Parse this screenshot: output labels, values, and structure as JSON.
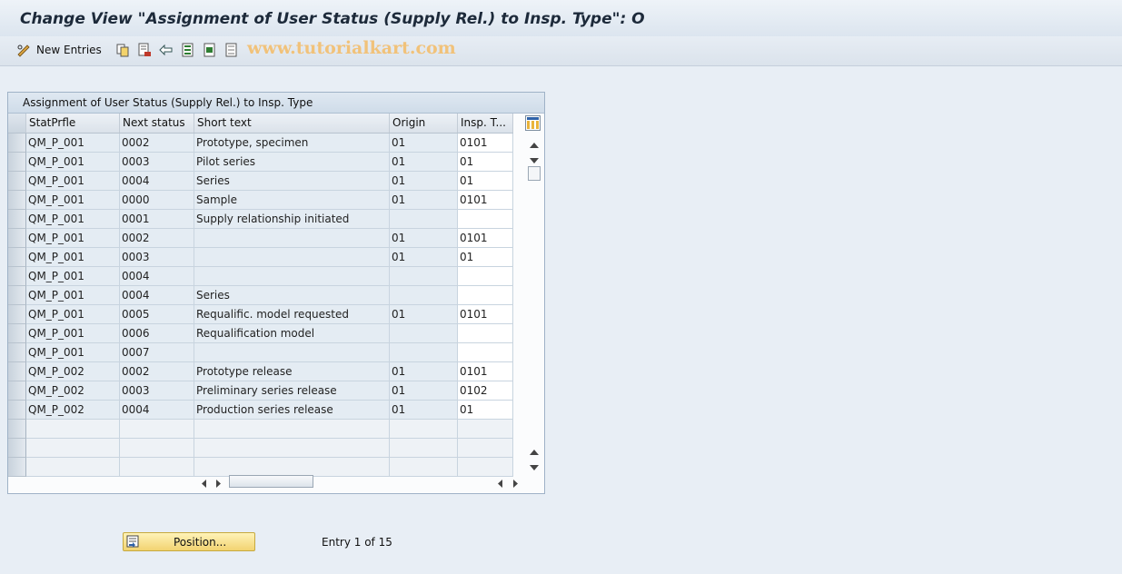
{
  "window": {
    "title": "Change View \"Assignment of User Status (Supply Rel.) to Insp. Type\": O"
  },
  "toolbar": {
    "new_entries_label": "New Entries",
    "icons": [
      "edit-glasses-icon",
      "copy-icon",
      "delete-icon",
      "undo-icon",
      "select-all-icon",
      "select-block-icon",
      "deselect-all-icon"
    ]
  },
  "watermark": "www.tutorialkart.com",
  "table": {
    "title": "Assignment of User Status (Supply Rel.) to Insp. Type",
    "columns": [
      "StatPrfle",
      "Next status",
      "Short text",
      "Origin",
      "Insp. T..."
    ],
    "rows": [
      [
        "QM_P_001",
        "0002",
        "Prototype, specimen",
        "01",
        "0101"
      ],
      [
        "QM_P_001",
        "0003",
        "Pilot series",
        "01",
        "01"
      ],
      [
        "QM_P_001",
        "0004",
        "Series",
        "01",
        "01"
      ],
      [
        "QM_P_001",
        "0000",
        "Sample",
        "01",
        "0101"
      ],
      [
        "QM_P_001",
        "0001",
        "Supply relationship initiated",
        "",
        ""
      ],
      [
        "QM_P_001",
        "0002",
        "",
        "01",
        "0101"
      ],
      [
        "QM_P_001",
        "0003",
        "",
        "01",
        "01"
      ],
      [
        "QM_P_001",
        "0004",
        "",
        "",
        ""
      ],
      [
        "QM_P_001",
        "0004",
        "Series",
        "",
        ""
      ],
      [
        "QM_P_001",
        "0005",
        "Requalific. model requested",
        "01",
        "0101"
      ],
      [
        "QM_P_001",
        "0006",
        "Requalification model",
        "",
        ""
      ],
      [
        "QM_P_001",
        "0007",
        "",
        "",
        ""
      ],
      [
        "QM_P_002",
        "0002",
        "Prototype release",
        "01",
        "0101"
      ],
      [
        "QM_P_002",
        "0003",
        "Preliminary series release",
        "01",
        "0102"
      ],
      [
        "QM_P_002",
        "0004",
        "Production series release",
        "01",
        "01"
      ]
    ]
  },
  "footer": {
    "position_button_label": "Position...",
    "entry_info": "Entry 1 of 15"
  },
  "colors": {
    "accent_button": "#f2d371",
    "header_text": "#1d2a3a",
    "editable_cell": "#ffffff",
    "readonly_cell": "#e4ecf3"
  }
}
